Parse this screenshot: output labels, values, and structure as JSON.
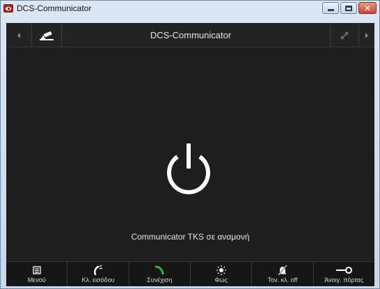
{
  "window": {
    "title": "DCS-Communicator",
    "app_icon": "eye-icon"
  },
  "topbar": {
    "title": "DCS-Communicator",
    "left_arrow_icon": "arrow-left-icon",
    "camera_icon": "camera-icon",
    "expand_icon": "expand-icon",
    "right_arrow_icon": "arrow-right-icon"
  },
  "main": {
    "icon": "power-icon",
    "status": "Communicator TKS σε αναμονή"
  },
  "bottombar": {
    "items": [
      {
        "label": "Μενού",
        "icon": "menu-icon",
        "color": "#ffffff"
      },
      {
        "label": "Κλ. εισόδου",
        "icon": "phone-call-icon",
        "color": "#ffffff"
      },
      {
        "label": "Συνέχιση",
        "icon": "phone-green-icon",
        "color": "#2ec24a"
      },
      {
        "label": "Φως",
        "icon": "light-icon",
        "color": "#ffffff"
      },
      {
        "label": "Τον. κλ. off",
        "icon": "bell-off-icon",
        "color": "#ffffff"
      },
      {
        "label": "Άνοιγ. πόρτας",
        "icon": "key-icon",
        "color": "#ffffff"
      }
    ]
  },
  "colors": {
    "background": "#1e1e1e",
    "accent_green": "#2ec24a",
    "text": "#e4e4e4"
  }
}
